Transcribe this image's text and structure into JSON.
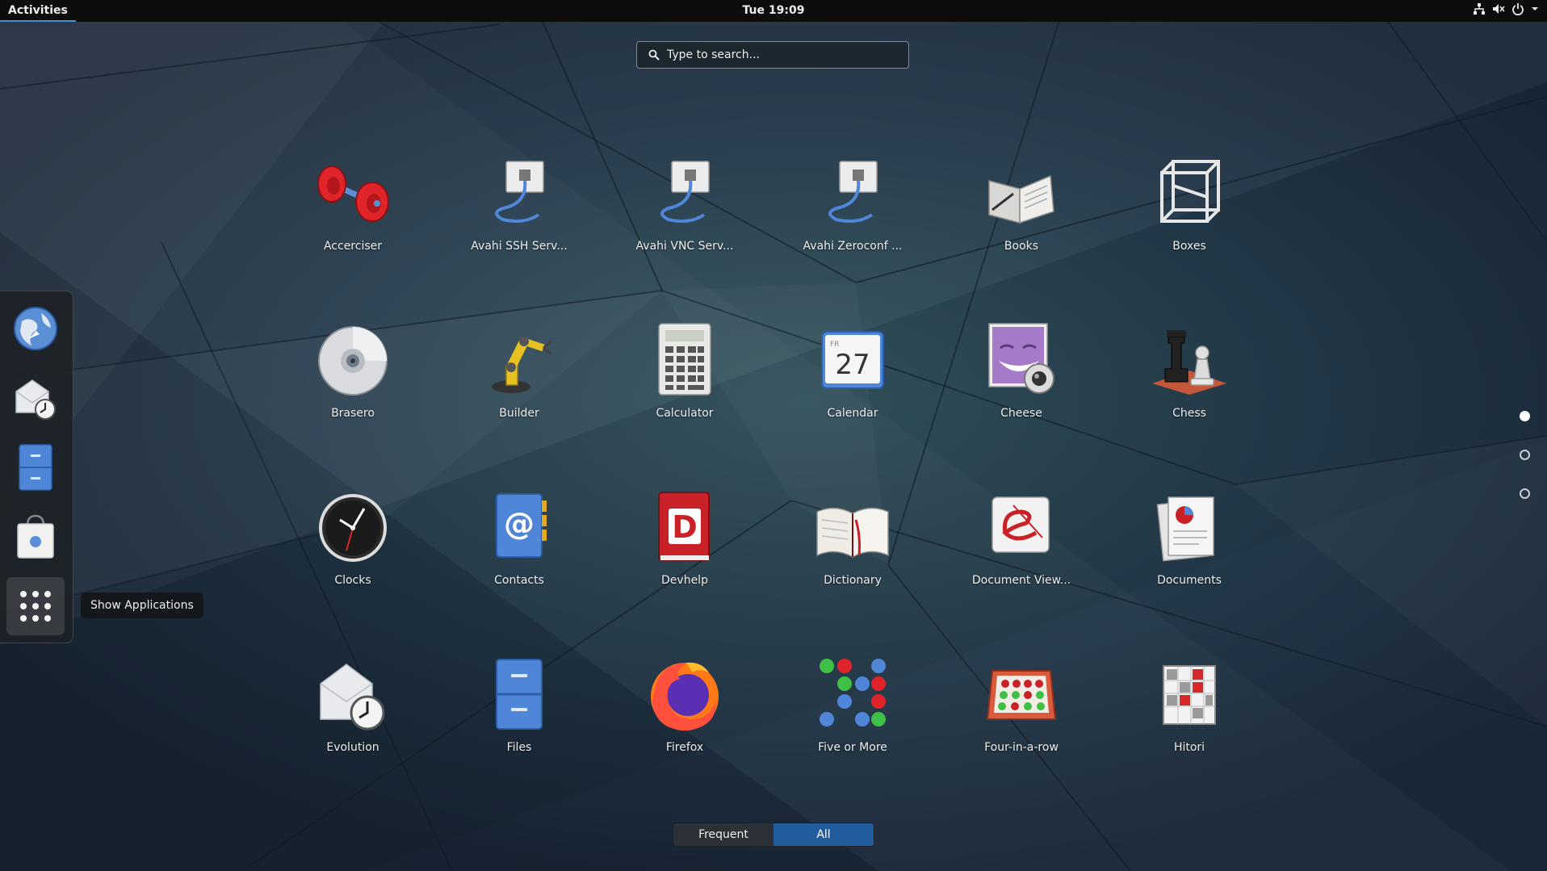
{
  "topbar": {
    "activities": "Activities",
    "clock": "Tue 19:09",
    "status_icons": [
      "network-icon",
      "volume-muted-icon",
      "power-icon",
      "dropdown-arrow-icon"
    ]
  },
  "search": {
    "placeholder": "Type to search...",
    "value": ""
  },
  "dash": {
    "items": [
      {
        "name": "web-browser",
        "icon": "globe-icon"
      },
      {
        "name": "evolution",
        "icon": "mail-clock-icon"
      },
      {
        "name": "files",
        "icon": "file-cabinet-icon"
      },
      {
        "name": "software",
        "icon": "shopping-bag-icon"
      },
      {
        "name": "show-applications",
        "icon": "app-grid-icon"
      }
    ],
    "tooltip": "Show Applications"
  },
  "apps": [
    {
      "label": "Accerciser",
      "icon": "dumbbell-icon"
    },
    {
      "label": "Avahi SSH Serv...",
      "icon": "network-cable-icon"
    },
    {
      "label": "Avahi VNC Serv...",
      "icon": "network-cable-icon"
    },
    {
      "label": "Avahi Zeroconf ...",
      "icon": "network-cable-icon"
    },
    {
      "label": "Books",
      "icon": "open-book-icon"
    },
    {
      "label": "Boxes",
      "icon": "wireframe-cube-icon"
    },
    {
      "label": "Brasero",
      "icon": "disc-icon"
    },
    {
      "label": "Builder",
      "icon": "robot-arm-icon"
    },
    {
      "label": "Calculator",
      "icon": "calculator-icon"
    },
    {
      "label": "Calendar",
      "icon": "calendar-icon",
      "day_abbr": "FR",
      "day_number": "27"
    },
    {
      "label": "Cheese",
      "icon": "webcam-face-icon"
    },
    {
      "label": "Chess",
      "icon": "chess-pieces-icon"
    },
    {
      "label": "Clocks",
      "icon": "clock-icon"
    },
    {
      "label": "Contacts",
      "icon": "address-book-icon"
    },
    {
      "label": "Devhelp",
      "icon": "devhelp-book-icon"
    },
    {
      "label": "Dictionary",
      "icon": "dictionary-book-icon"
    },
    {
      "label": "Document View...",
      "icon": "document-viewer-icon"
    },
    {
      "label": "Documents",
      "icon": "documents-stack-icon"
    },
    {
      "label": "Evolution",
      "icon": "mail-clock-icon"
    },
    {
      "label": "Files",
      "icon": "file-cabinet-icon"
    },
    {
      "label": "Firefox",
      "icon": "firefox-icon"
    },
    {
      "label": "Five or More",
      "icon": "colored-balls-icon"
    },
    {
      "label": "Four-in-a-row",
      "icon": "four-in-a-row-icon"
    },
    {
      "label": "Hitori",
      "icon": "hitori-grid-icon"
    }
  ],
  "pagination": {
    "pages": 3,
    "current": 1
  },
  "view_switch": {
    "frequent": "Frequent",
    "all": "All",
    "selected": "All"
  },
  "colors": {
    "accent": "#215d9c",
    "topbar": "#0d0d0d",
    "activities_underline": "#4a90d9"
  }
}
